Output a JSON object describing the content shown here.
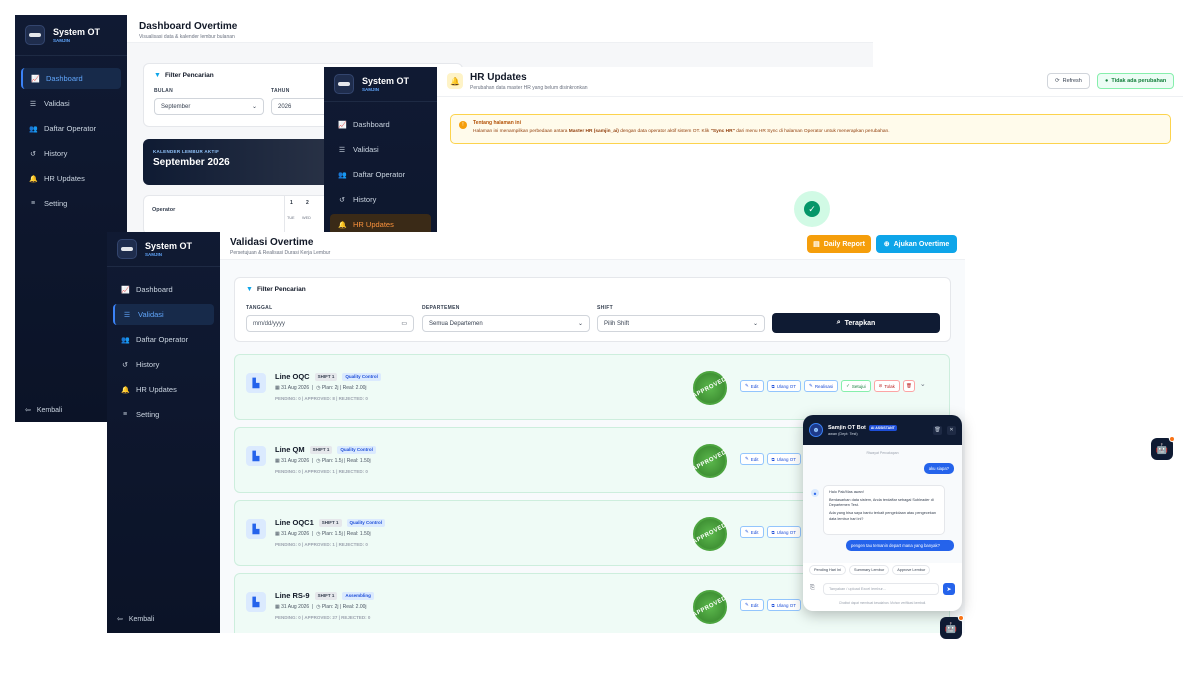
{
  "brand": {
    "title": "System OT",
    "sub": "SAMJIN"
  },
  "dashboard": {
    "title": "Dashboard Overtime",
    "subtitle": "Visualisasi data & kalender lembur bulanan",
    "filter_title": "Filter Pencarian",
    "bulan_label": "BULAN",
    "bulan_value": "September",
    "tahun_label": "TAHUN",
    "tahun_value": "2026",
    "cal_badge": "KALENDER LEMBUR AKTIF",
    "cal_month": "September 2026",
    "operator_label": "Operator",
    "day_1": "1",
    "day_2": "2",
    "dow_1": "TUE",
    "dow_2": "WED",
    "nav": [
      "Dashboard",
      "Validasi",
      "Daftar Operator",
      "History",
      "HR Updates",
      "Setting"
    ],
    "back": "Kembali"
  },
  "hr": {
    "title": "HR Updates",
    "subtitle": "Perubahan data master HR yang belum disinkronkan",
    "refresh": "Refresh",
    "status": "Tidak ada perubahan",
    "info_title": "Tentang halaman ini",
    "info_text_1": "Halaman ini menampilkan perbedaan antara ",
    "info_bold_1": "Master HR (samjin_ai)",
    "info_text_2": " dengan data operator aktif sistem OT. Klik ",
    "info_bold_2": "\"Sync HR\"",
    "info_text_3": " dari menu HR Sync di halaman Operator untuk menerapkan perubahan.",
    "nav": [
      "Dashboard",
      "Validasi",
      "Daftar Operator",
      "History",
      "HR Updates"
    ]
  },
  "validasi": {
    "title": "Validasi Overtime",
    "subtitle": "Persetujuan & Realisasi Durasi Kerja Lembur",
    "daily_report": "Daily Report",
    "ajukan": "Ajukan Overtime",
    "filter_title": "Filter Pencarian",
    "tanggal_label": "TANGGAL",
    "tanggal_placeholder": "mm/dd/yyyy",
    "dept_label": "DEPARTEMEN",
    "dept_value": "Semua Departemen",
    "shift_label": "SHIFT",
    "shift_value": "Pilih Shift",
    "apply": "Terapkan",
    "nav": [
      "Dashboard",
      "Validasi",
      "Daftar Operator",
      "History",
      "HR Updates",
      "Setting"
    ],
    "back": "Kembali",
    "stamp": "APPROVED",
    "actions": {
      "edit": "Edit",
      "ulang": "Ulang OT",
      "realisasi": "Realisasi",
      "setuju": "Setujui",
      "tolak": "Tolak"
    },
    "rows": [
      {
        "name": "Line OQC",
        "shift": "SHIFT 1",
        "dept": "Quality Control",
        "date": "31 Aug 2026",
        "plan": "Plan: 2j | Real: 2.00j",
        "stats": "PENDING: 0 | APPROVED: 8 | REJECTED: 0"
      },
      {
        "name": "Line QM",
        "shift": "SHIFT 1",
        "dept": "Quality Control",
        "date": "31 Aug 2026",
        "plan": "Plan: 1.5j | Real: 1.50j",
        "stats": "PENDING: 0 | APPROVED: 1 | REJECTED: 0"
      },
      {
        "name": "Line OQC1",
        "shift": "SHIFT 1",
        "dept": "Quality Control",
        "date": "31 Aug 2026",
        "plan": "Plan: 1.5j | Real: 1.50j",
        "stats": "PENDING: 0 | APPROVED: 1 | REJECTED: 0"
      },
      {
        "name": "Line RS-9",
        "shift": "SHIFT 1",
        "dept": "Assembling",
        "date": "31 Aug 2026",
        "plan": "Plan: 2j | Real: 2.00j",
        "stats": "PENDING: 0 | APPROVED: 27 | REJECTED: 0"
      }
    ]
  },
  "chat": {
    "name": "Samjin OT Bot",
    "badge": "AI ASSISTANT",
    "sub": "awan (Dept: Test)",
    "divider": "Riwayat Percakapan",
    "user_1": "aku siapa?",
    "bot_1_a": "Halo Pak/Mas awan!",
    "bot_1_b": "Berdasarkan data sistem, Anda terdaftar sebagai Subleader di Departemen Test.",
    "bot_1_c": "Ada yang bisa saya bantu terkait pengelolaan atau pengecekan data lembur hari ini?",
    "user_2": "pengen tau temanin depart mana yang banyak?",
    "chips": [
      "Pending Hari Ini",
      "Summary Lembur",
      "Approve Lembur"
    ],
    "input_placeholder": "Tanyakan / upload Excel lembur...",
    "footer": "Chatbot dapat membuat kesalahan. Mohon verifikasi kembali."
  }
}
